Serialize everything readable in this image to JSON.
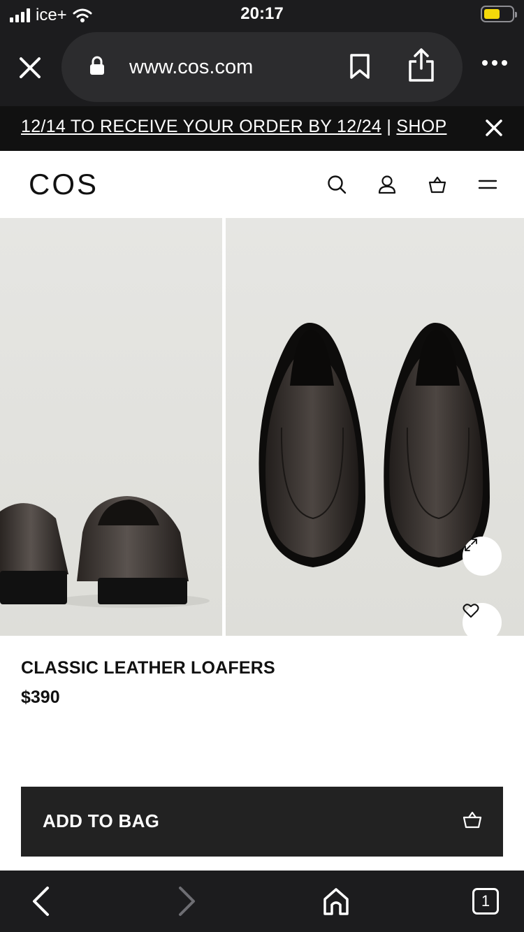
{
  "status_bar": {
    "carrier": "ice+",
    "time": "20:17",
    "battery_color": "#f5d90a"
  },
  "browser": {
    "url": "www.cos.com",
    "icons": [
      "close-icon",
      "lock-icon",
      "bookmark-icon",
      "share-icon",
      "more-icon"
    ]
  },
  "promo": {
    "text_main": "12/14 TO RECEIVE YOUR ORDER BY 12/24",
    "separator": " | ",
    "text_link": "SHOP"
  },
  "site_header": {
    "logo": "COS",
    "icons": [
      "search-icon",
      "account-icon",
      "bag-icon",
      "menu-icon"
    ]
  },
  "gallery": {
    "icons": [
      "expand-icon",
      "heart-icon"
    ]
  },
  "product": {
    "name": "CLASSIC LEATHER LOAFERS",
    "price": "$390"
  },
  "cta": {
    "label": "ADD TO BAG",
    "icon": "bag-icon"
  },
  "toolbar": {
    "tab_count": "1",
    "icons": [
      "back-icon",
      "forward-icon",
      "home-icon",
      "tabs-icon"
    ]
  },
  "colors": {
    "chrome": "#1c1c1e",
    "promo_bg": "#111111",
    "button_bg": "#222222",
    "image_bg": "#e6e6e3"
  }
}
